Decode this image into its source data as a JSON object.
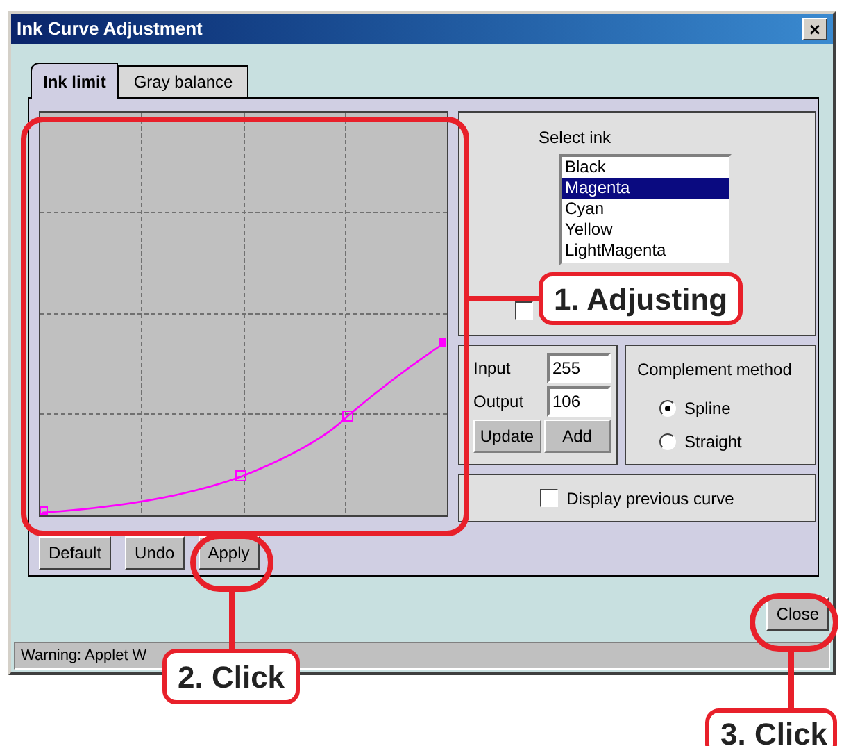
{
  "window": {
    "title": "Ink Curve Adjustment",
    "close": "×"
  },
  "tabs": [
    {
      "label": "Ink limit",
      "selected": true
    },
    {
      "label": "Gray balance",
      "selected": false
    }
  ],
  "select_ink": {
    "label": "Select ink",
    "items": [
      {
        "label": "Black",
        "selected": false
      },
      {
        "label": "Magenta",
        "selected": true
      },
      {
        "label": "Cyan",
        "selected": false
      },
      {
        "label": "Yellow",
        "selected": false
      },
      {
        "label": "LightMagenta",
        "selected": false
      }
    ]
  },
  "display_all_checkbox": {
    "checked": false
  },
  "point": {
    "input_label": "Input",
    "input_value": "255",
    "output_label": "Output",
    "output_value": "106",
    "buttons": [
      "Update",
      "Add"
    ]
  },
  "complement_method": {
    "label": "Complement method",
    "options": [
      {
        "label": "Spline",
        "selected": true
      },
      {
        "label": "Straight",
        "selected": false
      }
    ]
  },
  "display_previous": {
    "label": "Display previous curve",
    "checked": false
  },
  "curve_buttons": [
    "Default",
    "Undo",
    "Apply"
  ],
  "close_button": "Close",
  "status_bar": "Warning: Applet W",
  "annotations": [
    "1. Adjusting",
    "2. Click",
    "3. Click"
  ]
}
